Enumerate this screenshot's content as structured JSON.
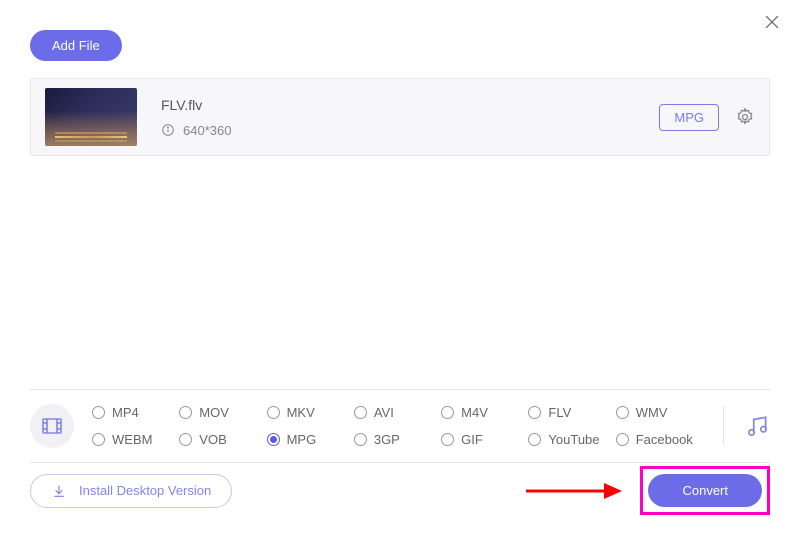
{
  "header": {
    "add_file_label": "Add File"
  },
  "file": {
    "name": "FLV.flv",
    "dimensions": "640*360",
    "output_format": "MPG"
  },
  "formats": {
    "items": [
      {
        "label": "MP4",
        "checked": false
      },
      {
        "label": "MOV",
        "checked": false
      },
      {
        "label": "MKV",
        "checked": false
      },
      {
        "label": "AVI",
        "checked": false
      },
      {
        "label": "M4V",
        "checked": false
      },
      {
        "label": "FLV",
        "checked": false
      },
      {
        "label": "WMV",
        "checked": false
      },
      {
        "label": "WEBM",
        "checked": false
      },
      {
        "label": "VOB",
        "checked": false
      },
      {
        "label": "MPG",
        "checked": true
      },
      {
        "label": "3GP",
        "checked": false
      },
      {
        "label": "GIF",
        "checked": false
      },
      {
        "label": "YouTube",
        "checked": false
      },
      {
        "label": "Facebook",
        "checked": false
      }
    ]
  },
  "footer": {
    "install_label": "Install Desktop Version",
    "convert_label": "Convert"
  }
}
